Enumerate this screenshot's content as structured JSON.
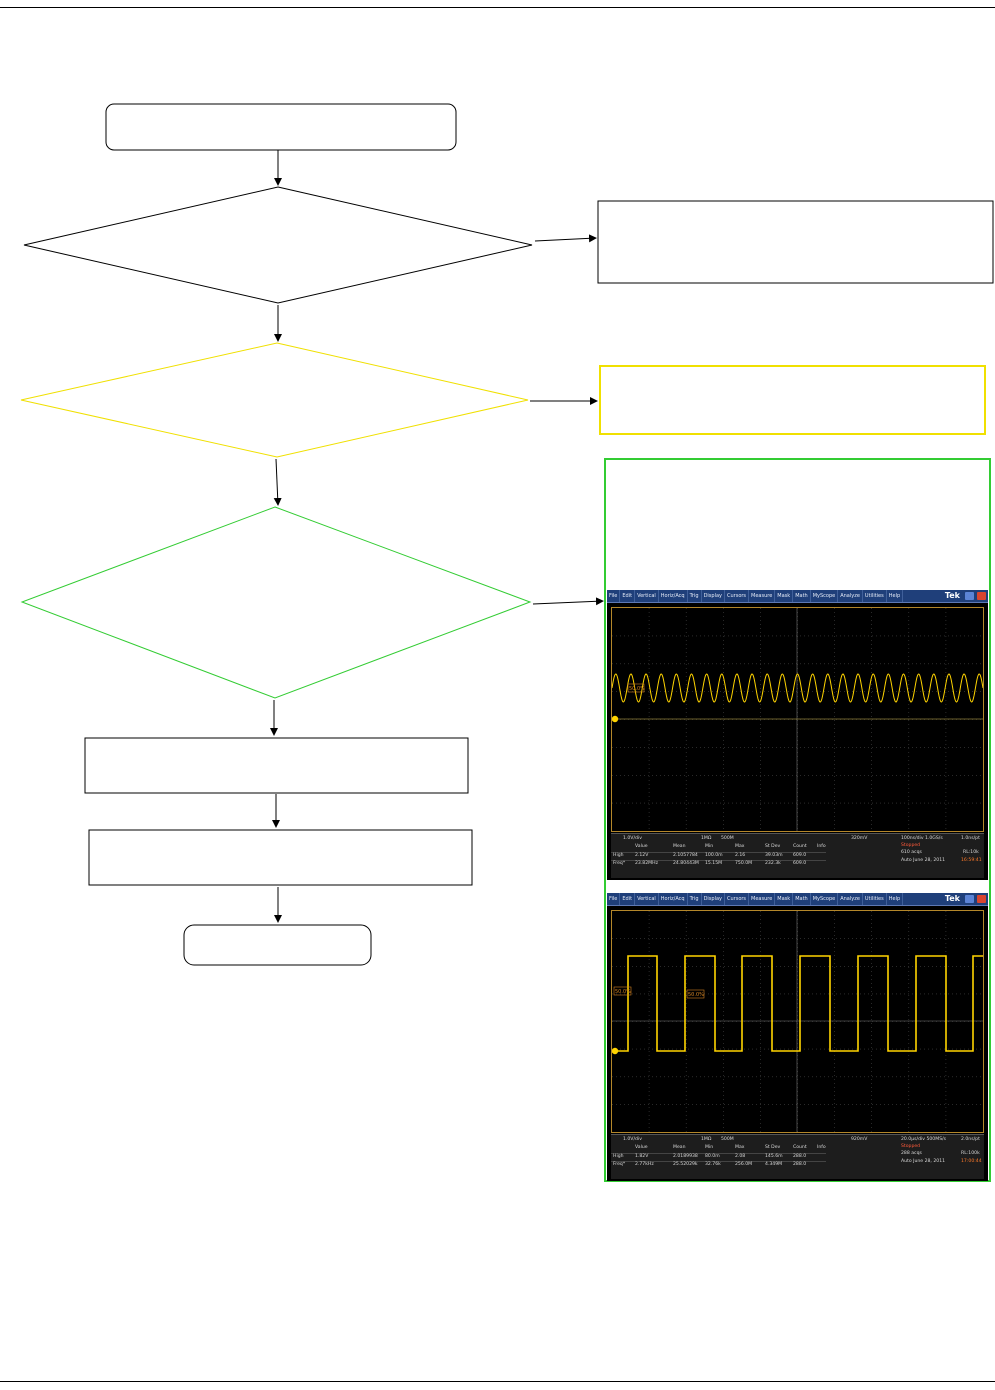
{
  "diagram": {
    "boxes": [
      {
        "id": "start",
        "text": ""
      },
      {
        "id": "right-box-1",
        "text": ""
      },
      {
        "id": "right-box-2",
        "text": ""
      },
      {
        "id": "right-box-3",
        "text": ""
      },
      {
        "id": "box-4",
        "text": ""
      },
      {
        "id": "box-5",
        "text": ""
      },
      {
        "id": "end",
        "text": ""
      }
    ],
    "decisions": [
      {
        "id": "decision-1",
        "text": ""
      },
      {
        "id": "decision-2",
        "text": ""
      },
      {
        "id": "decision-3",
        "text": ""
      }
    ],
    "colors": {
      "line": "#000000",
      "yellow": "#f0e000",
      "green": "#33cc33",
      "trace": "#ffd400"
    }
  },
  "scope_1": {
    "menu": [
      "File",
      "Edit",
      "Vertical",
      "Horiz/Acq",
      "Trig",
      "Display",
      "Cursors",
      "Measure",
      "Mask",
      "Math",
      "MyScope",
      "Analyze",
      "Utilities",
      "Help"
    ],
    "brand": "Tek",
    "marker_label": "50.0%",
    "channel": "1.0V/div",
    "impedance": "1MΩ",
    "bw": "500M",
    "trigger": "320mV",
    "horiz": "100ns/div  1.0GS/s",
    "resolution": "1.0ns/pt",
    "state": "Stopped",
    "acqs": "610 acqs",
    "record": "RL:10k",
    "mode_date": "Auto   June 28, 2011",
    "time": "16:59:41",
    "headers": [
      "Value",
      "Mean",
      "Min",
      "Max",
      "St Dev",
      "Count",
      "Info"
    ],
    "rows": [
      {
        "name": "High",
        "values": [
          "2.12V",
          "2.1057784",
          "100.0m",
          "2.16",
          "39.03m",
          "609.0"
        ]
      },
      {
        "name": "Freq*",
        "values": [
          "23.82MHz",
          "24.80443M",
          "15.15M",
          "750.0M",
          "232.3k",
          "609.0"
        ]
      }
    ]
  },
  "scope_2": {
    "menu": [
      "File",
      "Edit",
      "Vertical",
      "Horiz/Acq",
      "Trig",
      "Display",
      "Cursors",
      "Measure",
      "Mask",
      "Math",
      "MyScope",
      "Analyze",
      "Utilities",
      "Help"
    ],
    "brand": "Tek",
    "marker_labels": [
      "50.0%",
      "50.0%"
    ],
    "channel": "1.0V/div",
    "impedance": "1MΩ",
    "bw": "500M",
    "trigger": "920mV",
    "horiz": "20.0µs/div  500MS/s",
    "resolution": "2.0ns/pt",
    "state": "Stopped",
    "acqs": "288 acqs",
    "record": "RL:100k",
    "mode_date": "Auto   June 28, 2011",
    "time": "17:00:44",
    "headers": [
      "Value",
      "Mean",
      "Min",
      "Max",
      "St Dev",
      "Count",
      "Info"
    ],
    "rows": [
      {
        "name": "High",
        "values": [
          "1.82V",
          "2.0189938",
          "80.0m",
          "2.08",
          "145.6m",
          "288.0"
        ]
      },
      {
        "name": "Freq*",
        "values": [
          "2.77kHz",
          "25.52029k",
          "32.76k",
          "256.0M",
          "4.349M",
          "288.0"
        ]
      }
    ]
  }
}
